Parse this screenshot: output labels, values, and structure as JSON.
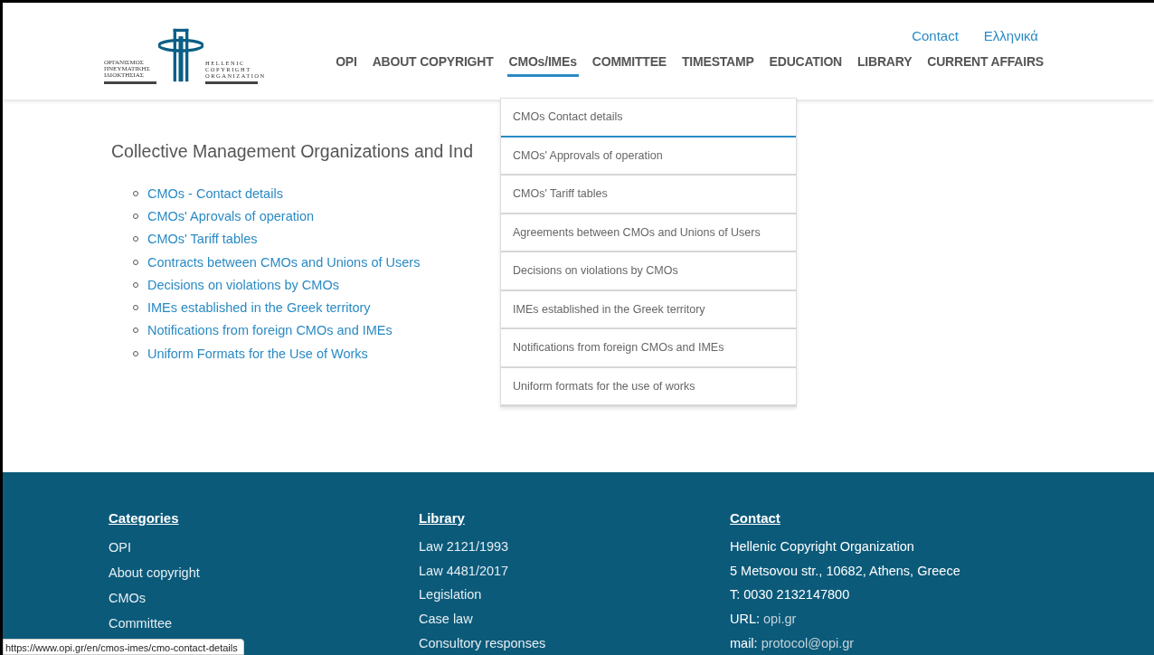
{
  "logo": {
    "greek_lines": [
      "ΟΡΓΑΝΙΣΜΟΣ",
      "ΠΝΕΥΜΑΤΙΚΗΣ",
      "ΙΔΙΟΚΤΗΣΙΑΣ"
    ],
    "english_lines": [
      "HELLENIC",
      "COPYRIGHT",
      "ORGANIZATION"
    ]
  },
  "top_links": [
    "Contact",
    "Ελληνικά"
  ],
  "nav": [
    {
      "label": "OPI",
      "selected": false
    },
    {
      "label": "ABOUT COPYRIGHT",
      "selected": false
    },
    {
      "label": "CMOs/IMEs",
      "selected": true
    },
    {
      "label": "COMMITTEE",
      "selected": false
    },
    {
      "label": "TIMESTAMP",
      "selected": false
    },
    {
      "label": "EDUCATION",
      "selected": false
    },
    {
      "label": "LIBRARY",
      "selected": false
    },
    {
      "label": "CURRENT AFFAIRS",
      "selected": false
    }
  ],
  "dropdown": [
    {
      "label": "CMOs Contact details",
      "selected": true
    },
    {
      "label": "CMOs' Approvals of operation",
      "selected": false
    },
    {
      "label": "CMOs' Tariff tables",
      "selected": false
    },
    {
      "label": "Agreements between CMOs and Unions of Users",
      "selected": false
    },
    {
      "label": "Decisions on violations by CMOs",
      "selected": false
    },
    {
      "label": "IMEs established in the Greek territory",
      "selected": false
    },
    {
      "label": "Notifications from foreign CMOs and IMEs",
      "selected": false
    },
    {
      "label": "Uniform formats for the use of works",
      "selected": false
    }
  ],
  "heading": "Collective Management Organizations and Ind",
  "links": [
    "CMOs - Contact details",
    "CMOs' Aprovals of operation",
    "CMOs' Tariff tables",
    "Contracts between CMOs and Unions of Users",
    "Decisions on violations by CMOs",
    "IMEs established in the Greek territory",
    "Notifications from foreign CMOs and IMEs",
    "Uniform Formats for the Use of Works"
  ],
  "footer": {
    "categories": {
      "title": "Categories",
      "items": [
        "OPI",
        "About copyright",
        "CMOs",
        "Committee"
      ]
    },
    "library": {
      "title": "Library",
      "items": [
        "Law 2121/1993",
        "Law 4481/2017",
        "Legislation",
        "Case law",
        "Consultory responses"
      ]
    },
    "contact": {
      "title": "Contact",
      "lines": [
        {
          "label": "Hellenic Copyright Organization"
        },
        {
          "label": "5 Metsovou str., 10682, Athens, Greece"
        },
        {
          "label": "T: 0030 2132147800"
        },
        {
          "label": "URL:",
          "link": "opi.gr"
        },
        {
          "label": "mail:",
          "link": "protocol@opi.gr"
        }
      ]
    }
  },
  "status_bar": {
    "url": "https://www.opi.gr/en/cmos-imes/cmo-contact-details"
  }
}
